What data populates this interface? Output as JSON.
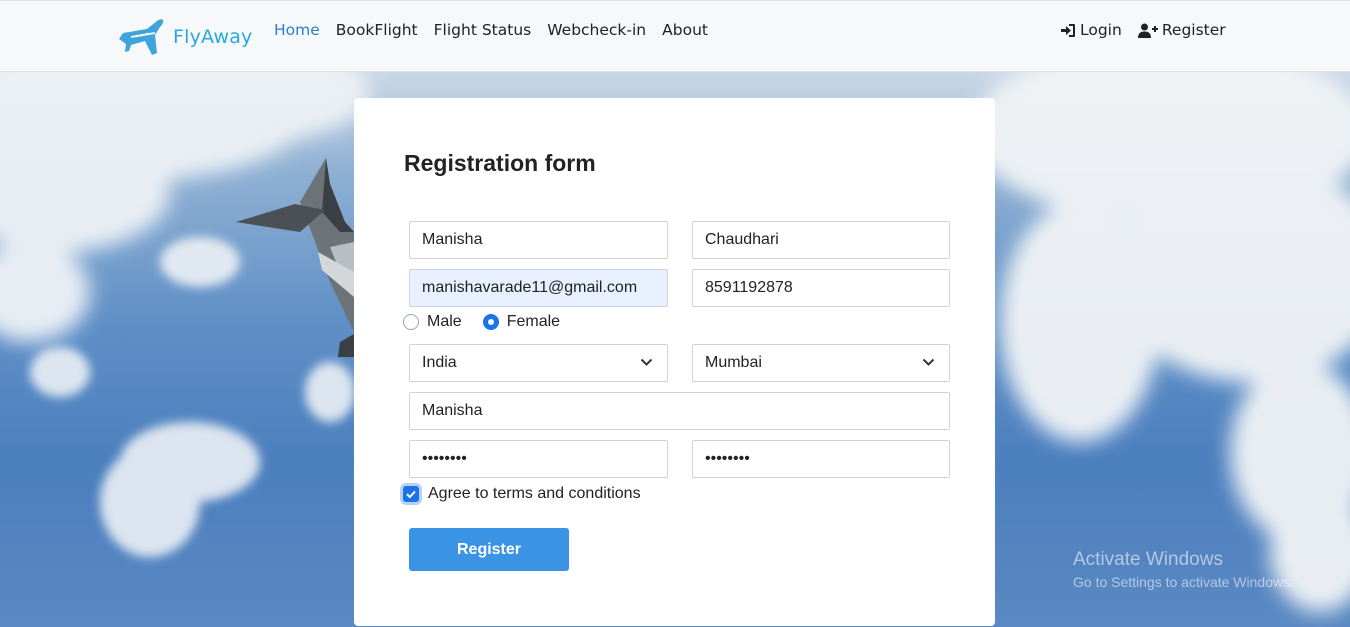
{
  "navbar": {
    "brand": "FlyAway",
    "links": [
      "Home",
      "BookFlight",
      "Flight Status",
      "Webcheck-in",
      "About"
    ],
    "active_link": "Home",
    "login_label": "Login",
    "register_label": "Register"
  },
  "form": {
    "title": "Registration form",
    "first_name": "Manisha",
    "last_name": "Chaudhari",
    "email": "manishavarade11@gmail.com",
    "phone": "8591192878",
    "gender_options": [
      "Male",
      "Female"
    ],
    "gender_selected": "Female",
    "country": "India",
    "city": "Mumbai",
    "username": "Manisha",
    "password": "••••••••",
    "confirm_password": "••••••••",
    "terms_label": "Agree to terms and conditions",
    "terms_checked": true,
    "submit_label": "Register"
  },
  "watermark": {
    "title": "Activate Windows",
    "subtitle": "Go to Settings to activate Windows."
  },
  "colors": {
    "brand": "#29a8e0",
    "active_link": "#2a7fd4",
    "primary_button": "#3a93e4",
    "checked": "#1a73e8"
  },
  "icons": {
    "brand_logo": "airplane-icon",
    "login": "sign-in-icon",
    "register": "user-plus-icon",
    "select": "chevron-down-icon",
    "checkbox": "check-icon"
  }
}
